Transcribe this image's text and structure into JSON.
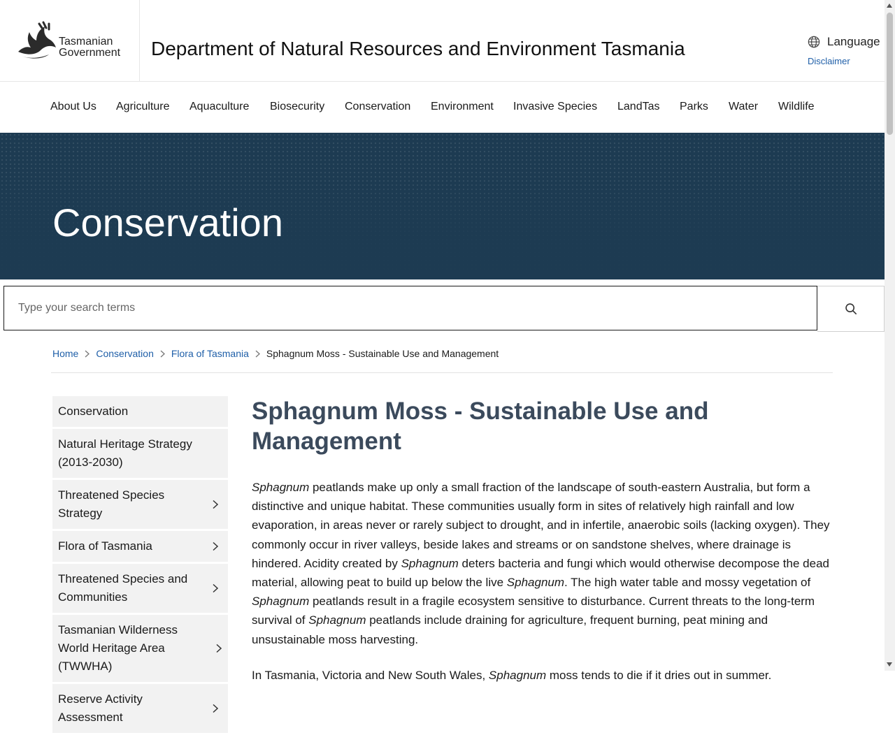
{
  "header": {
    "logo_line1": "Tasmanian",
    "logo_line2": "Government",
    "site_title": "Department of Natural Resources and Environment Tasmania",
    "language_label": "Language",
    "disclaimer_label": "Disclaimer"
  },
  "nav": {
    "items": [
      "About Us",
      "Agriculture",
      "Aquaculture",
      "Biosecurity",
      "Conservation",
      "Environment",
      "Invasive Species",
      "LandTas",
      "Parks",
      "Water",
      "Wildlife"
    ]
  },
  "banner": {
    "title": "Conservation"
  },
  "search": {
    "placeholder": "Type your search terms"
  },
  "breadcrumb": {
    "items": [
      "Home",
      "Conservation",
      "Flora of Tasmania"
    ],
    "current": "Sphagnum Moss - Sustainable Use and Management"
  },
  "sidebar": {
    "items": [
      {
        "label": "Conservation",
        "has_children": false
      },
      {
        "label": "Natural Heritage Strategy (2013-2030)",
        "has_children": false
      },
      {
        "label": "Threatened Species Strategy",
        "has_children": true
      },
      {
        "label": "Flora of Tasmania",
        "has_children": true
      },
      {
        "label": "Threatened Species and Communities",
        "has_children": true
      },
      {
        "label": "Tasmanian Wilderness World Heritage Area (TWWHA)",
        "has_children": true
      },
      {
        "label": "Reserve Activity Assessment",
        "has_children": true
      }
    ]
  },
  "main": {
    "title": "Sphagnum Moss - Sustainable Use and Management",
    "para1": [
      {
        "t": "Sphagnum",
        "i": true
      },
      {
        "t": " peatlands make up only a small fraction of the landscape of south-eastern Australia, but form a distinctive and unique habitat.  These communities usually form in sites of relatively high rainfall and low evaporation, in areas never or rarely subject to drought, and in infertile, anaerobic soils (lacking oxygen). They commonly occur in river valleys, beside lakes and streams or on sandstone shelves, where drainage is hindered. Acidity created by ",
        "i": false
      },
      {
        "t": "Sphagnum",
        "i": true
      },
      {
        "t": " deters bacteria and fungi which would otherwise decompose the dead material, allowing peat to build up below the live ",
        "i": false
      },
      {
        "t": "Sphagnum",
        "i": true
      },
      {
        "t": ". The high water table and mossy vegetation of ",
        "i": false
      },
      {
        "t": "Sphagnum",
        "i": true
      },
      {
        "t": " peatlands result in a fragile ecosystem sensitive to disturbance. Current threats to the long-term survival of ",
        "i": false
      },
      {
        "t": "Sphagnum",
        "i": true
      },
      {
        "t": " peatlands include draining for agriculture, frequent burning, peat mining and unsustainable moss harvesting.",
        "i": false
      }
    ],
    "para2": [
      {
        "t": "In Tasmania, Victoria and New South Wales, ",
        "i": false
      },
      {
        "t": "Sphagnum",
        "i": true
      },
      {
        "t": " moss tends to die if it dries out in summer.",
        "i": false
      }
    ]
  },
  "colors": {
    "banner_bg": "#1d3b52",
    "link": "#1f5fa8",
    "heading": "#3b4a5c",
    "sidebar_bg": "#f2f2f2"
  }
}
